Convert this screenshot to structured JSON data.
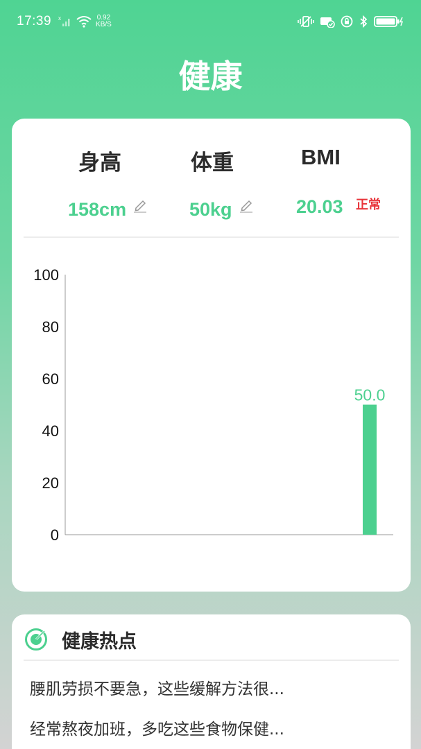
{
  "status_bar": {
    "time": "17:39",
    "speed_value": "0.92",
    "speed_unit": "KB/S"
  },
  "page": {
    "title": "健康"
  },
  "metrics": {
    "height_label": "身高",
    "weight_label": "体重",
    "bmi_label": "BMI",
    "height_value": "158cm",
    "weight_value": "50kg",
    "bmi_value": "20.03",
    "bmi_status": "正常"
  },
  "chart_data": {
    "type": "bar",
    "ylim": [
      0,
      100
    ],
    "yticks": [
      "100",
      "80",
      "60",
      "40",
      "20",
      "0"
    ],
    "values": [
      50.0
    ],
    "data_labels": [
      "50.0"
    ],
    "bar_color": "#4cd08f",
    "grid": false
  },
  "hot_news": {
    "title": "健康热点",
    "items": [
      "腰肌劳损不要急，这些缓解方法很...",
      "经常熬夜加班，多吃这些食物保健..."
    ]
  },
  "colors": {
    "accent": "#4cd08f",
    "warning": "#e8343a"
  },
  "icons": [
    "wifi-icon",
    "signal-icon",
    "vibrate-icon",
    "cast-icon",
    "lock-icon",
    "bluetooth-icon",
    "battery-icon",
    "edit-icon",
    "target-icon"
  ]
}
